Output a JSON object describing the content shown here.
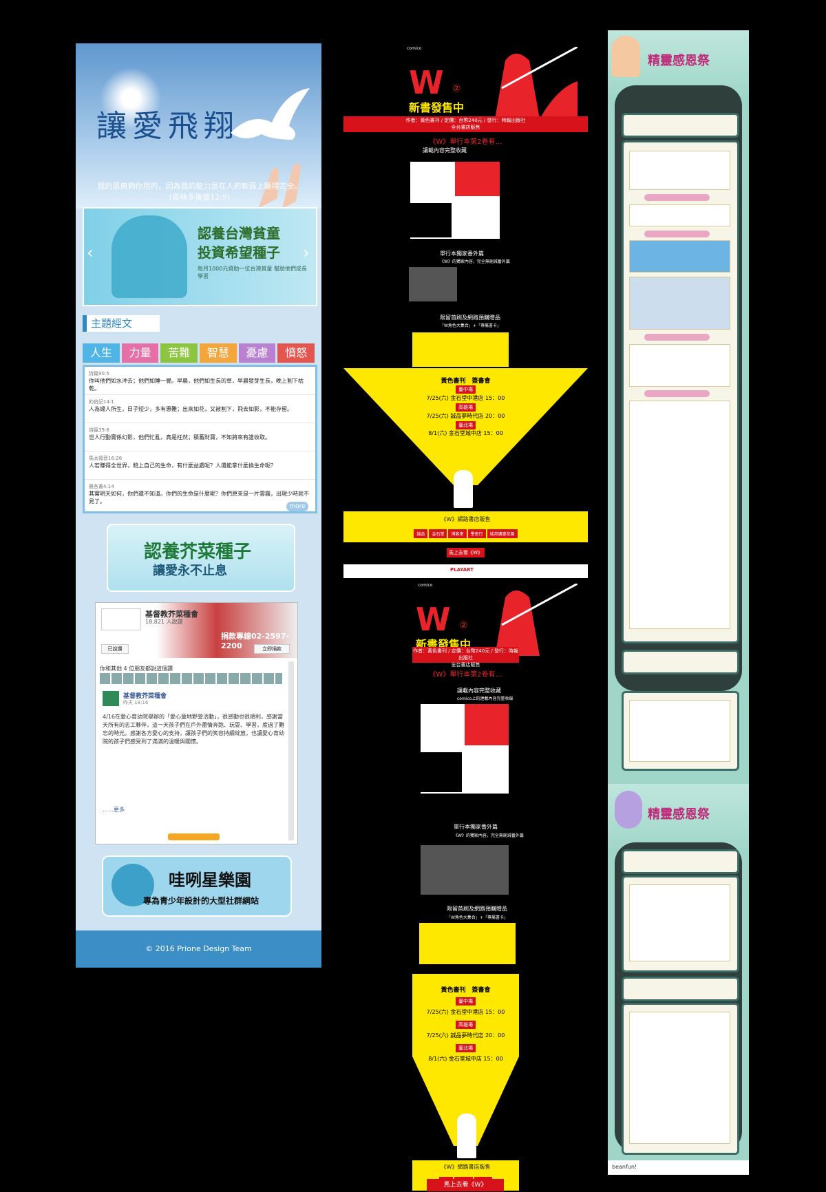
{
  "col1": {
    "hero_title": "讓愛飛翔",
    "verse": "我的恩典夠你用的，因為我的能力是在人的軟弱上顯得完全。",
    "verse_ref": "(哥林多後書12:9)",
    "banner_title1": "認養台灣貧童",
    "banner_title2": "投資希望種子",
    "banner_small": "每月1000元資助一位台灣貧童 幫助他們成長學習",
    "themes_heading": "主題經文",
    "tabs": [
      "人生",
      "力量",
      "苦難",
      "智慧",
      "憂慮",
      "憤怒"
    ],
    "tab_colors": [
      "#4fb4e6",
      "#e76fa8",
      "#8cc63f",
      "#f4a53b",
      "#b981d2",
      "#e5554f"
    ],
    "verses": [
      {
        "ref": "詩篇90:5",
        "text": "你叫他們如水沖去；他們如睡一覺。早晨，他們如生長的草，早晨發芽生長，晚上割下枯乾。"
      },
      {
        "ref": "約伯記14:1",
        "text": "人為婦人所生，日子短少，多有患難；出來如花，又被割下，飛去如影，不能存留。"
      },
      {
        "ref": "詩篇39:6",
        "text": "世人行動實係幻影，他們忙亂，真是枉然；積蓄財寶，不知將來有誰收取。"
      },
      {
        "ref": "馬太福音16:26",
        "text": "人若賺得全世界，賠上自己的生命，有什麼益處呢？人還能拿什麼換生命呢？"
      },
      {
        "ref": "雅各書4:14",
        "text": "其實明天如何，你們還不知道。你們的生命是什麼呢？你們原來是一片雲霧，出現少時就不見了。"
      }
    ],
    "more_label": "more",
    "seed_title1": "認養芥菜種子",
    "seed_title2": "讓愛永不止息",
    "fb_name": "基督教芥菜種會",
    "fb_likes": "18,821 人說讚",
    "fb_phone": "捐款專線02-2597-2200",
    "fb_liked": "已說讚",
    "fb_donate": "立即捐款",
    "fb_friends": "你和其他 4 位朋友都說這個讚",
    "fb_post_name": "基督教芥菜種會",
    "fb_post_time": "昨天 18:16",
    "fb_post_body": "4/16在愛心育幼院舉辦的「愛心童地野營活動」，很感動也很順利，感謝當天所有的志工夥伴，這一天孩子們在戶外盡情奔跑、玩耍、學習，度過了難忘的時光。感謝各方愛心的支持，讓孩子們的笑容持續綻放，也讓愛心育幼院的孩子們感受到了滿滿的溫暖與關懷。",
    "fb_more": "……更多",
    "wala_title": "哇咧星樂園",
    "wala_sub": "專為青少年設計的大型社群網站",
    "footer": "© 2016 Prione Design Team"
  },
  "col2": {
    "brand": "comico",
    "logo": "W",
    "badge": "②",
    "new_book": "新書發售中",
    "info_line1": "作者：黃色書刊 / 定價：台幣240元 / 發行：時報出版社",
    "info_line2": "全台書店販售",
    "subtitle": "《W》單行本第2卷有…",
    "feat1_title": "讓載內容完整收藏",
    "feat1_desc": "comico上的連載內容完整收錄",
    "feat2_title": "單行本獨家番外篇",
    "feat2_desc": "《W》的獨家內容，完全無刪減番外篇",
    "feat3_title": "限留首刷及網路預購贈品",
    "feat3_desc": "「W角色大集合」+「專屬書卡」",
    "event_title": "黃色書刊　簽書會",
    "events": [
      {
        "city": "臺中場",
        "detail": "7/25(六) 金石堂中港店 15：00"
      },
      {
        "city": "高雄場",
        "detail": "7/25(六) 誠品夢時代店 20：00"
      },
      {
        "city": "臺北場",
        "detail": "8/1(六) 金石堂城中店 15：00"
      }
    ],
    "store_title": "《W》網路書店販售",
    "stores": [
      "誠品",
      "金石堂",
      "博客來",
      "學思行",
      "城邦讀書花園"
    ],
    "cta": "馬上去看《W》",
    "publisher": "PLAYART"
  },
  "col3": {
    "title": "精靈感恩祭",
    "footer": "beanfun!"
  }
}
